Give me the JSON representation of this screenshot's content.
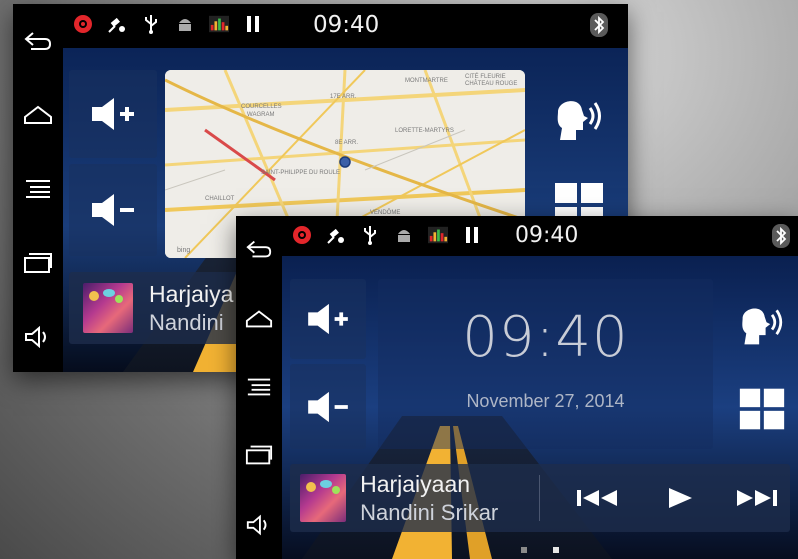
{
  "status_bar": {
    "time": "09:40",
    "icons": [
      "record-icon",
      "satellite-icon",
      "usb-icon",
      "android-icon",
      "equalizer-icon",
      "pause-icon"
    ],
    "bluetooth_icon": "bluetooth-icon"
  },
  "nav_bar": {
    "items": [
      "back-icon",
      "home-icon",
      "menu-icon",
      "recent-apps-icon",
      "volume-icon"
    ]
  },
  "back_screen": {
    "map": {
      "labels": [
        "MONTMARTRE",
        "CITÉ FLEURIE",
        "CHÂTEAU ROUGE",
        "17E ARR.",
        "COURCELLES",
        "WAGRAM",
        "LORETTE-MARTYRS",
        "8E ARR.",
        "SAINT-PHILIPPE DU ROULE",
        "CHAILLOT",
        "VENDÔME"
      ],
      "attribution": "bing"
    },
    "music": {
      "title": "Harjaiya",
      "artist": "Nandini"
    }
  },
  "front_screen": {
    "clock": {
      "time": "09:40",
      "date": "November 27, 2014"
    },
    "music": {
      "title": "Harjaiyaan",
      "artist": "Nandini Srikar"
    },
    "page_indicator": {
      "pages": 2,
      "active": 2
    }
  },
  "colors": {
    "accent_blue": "#12306c",
    "road_yellow": "#f2b233",
    "record_red": "#e3262b"
  }
}
